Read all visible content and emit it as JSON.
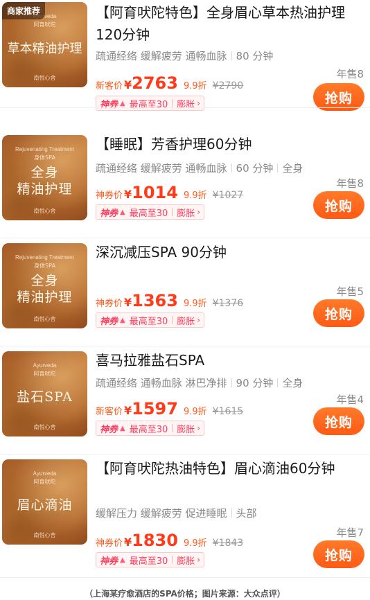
{
  "recommend_badge": "商家推荐",
  "items": [
    {
      "thumb": {
        "line1": "Ayurveda",
        "line2": "阿育吠陀",
        "main_lines": [
          "草本精油护理"
        ],
        "brand": "南悦心舍"
      },
      "title": "【阿育吠陀特色】全身眉心草本热油护理120分钟",
      "tags": [
        "疏通经络 缓解疲劳 通畅血脉",
        "80 分钟"
      ],
      "sold": "年售8",
      "price_label": "新客价",
      "currency": "¥",
      "price": "2763",
      "discount": "9.9折",
      "original_price": "¥2790",
      "coupon": {
        "brand": "神券",
        "cap": "最高至30",
        "expand": "膨胀"
      },
      "buy_label": "抢购"
    },
    {
      "thumb": {
        "line1": "Rejuvenating Treatment",
        "line2": "身体SPA",
        "main_lines": [
          "全身",
          "精油护理"
        ],
        "brand": "南悦心舍"
      },
      "title": "【睡眠】芳香护理60分钟",
      "tags": [
        "疏通经络 缓解疲劳 通畅血脉",
        "60 分钟",
        "全身"
      ],
      "sold": "年售8",
      "price_label": "神券价",
      "currency": "¥",
      "price": "1014",
      "discount": "9.9折",
      "original_price": "¥1027",
      "coupon": {
        "brand": "神券",
        "cap": "最高至30",
        "expand": "膨胀"
      },
      "buy_label": "抢购"
    },
    {
      "thumb": {
        "line1": "Rejuvenating Treatment",
        "line2": "身体SPA",
        "main_lines": [
          "全身",
          "精油护理"
        ],
        "brand": "南悦心舍"
      },
      "title": "深沉减压SPA 90分钟",
      "tags": [],
      "sold": "年售5",
      "price_label": "神券价",
      "currency": "¥",
      "price": "1363",
      "discount": "9.9折",
      "original_price": "¥1376",
      "coupon": {
        "brand": "神券",
        "cap": "最高至30",
        "expand": "膨胀"
      },
      "buy_label": "抢购"
    },
    {
      "thumb": {
        "line1": "Ayurveda",
        "line2": "阿育吠陀",
        "main_lines": [
          "盐石SPA"
        ],
        "brand": "南悦心舍"
      },
      "title": "喜马拉雅盐石SPA",
      "tags": [
        "疏通经络 通畅血脉 淋巴净排",
        "90 分钟",
        "全身"
      ],
      "sold": "年售4",
      "price_label": "新客价",
      "currency": "¥",
      "price": "1597",
      "discount": "9.9折",
      "original_price": "¥1615",
      "coupon": {
        "brand": "神券",
        "cap": "最高至30",
        "expand": "膨胀"
      },
      "buy_label": "抢购"
    },
    {
      "thumb": {
        "line1": "Ayurveda",
        "line2": "阿育吠陀",
        "main_lines": [
          "眉心滴油"
        ],
        "brand": "南悦心舍"
      },
      "title": "【阿育吠陀热油特色】眉心滴油60分钟",
      "tags": [
        "缓解压力 缓解疲劳 促进睡眠",
        "头部"
      ],
      "sold": "年售7",
      "price_label": "神券价",
      "currency": "¥",
      "price": "1830",
      "discount": "9.9折",
      "original_price": "¥1843",
      "coupon": {
        "brand": "神券",
        "cap": "最高至30",
        "expand": "膨胀"
      },
      "buy_label": "抢购"
    }
  ],
  "caption": "（上海某疗愈酒店的SPA价格；图片来源：大众点评）",
  "colors": {
    "accent": "#ff3b1a",
    "buy_button": "#ff6a1e",
    "coupon": "#ff3d5e",
    "muted": "#888888"
  }
}
